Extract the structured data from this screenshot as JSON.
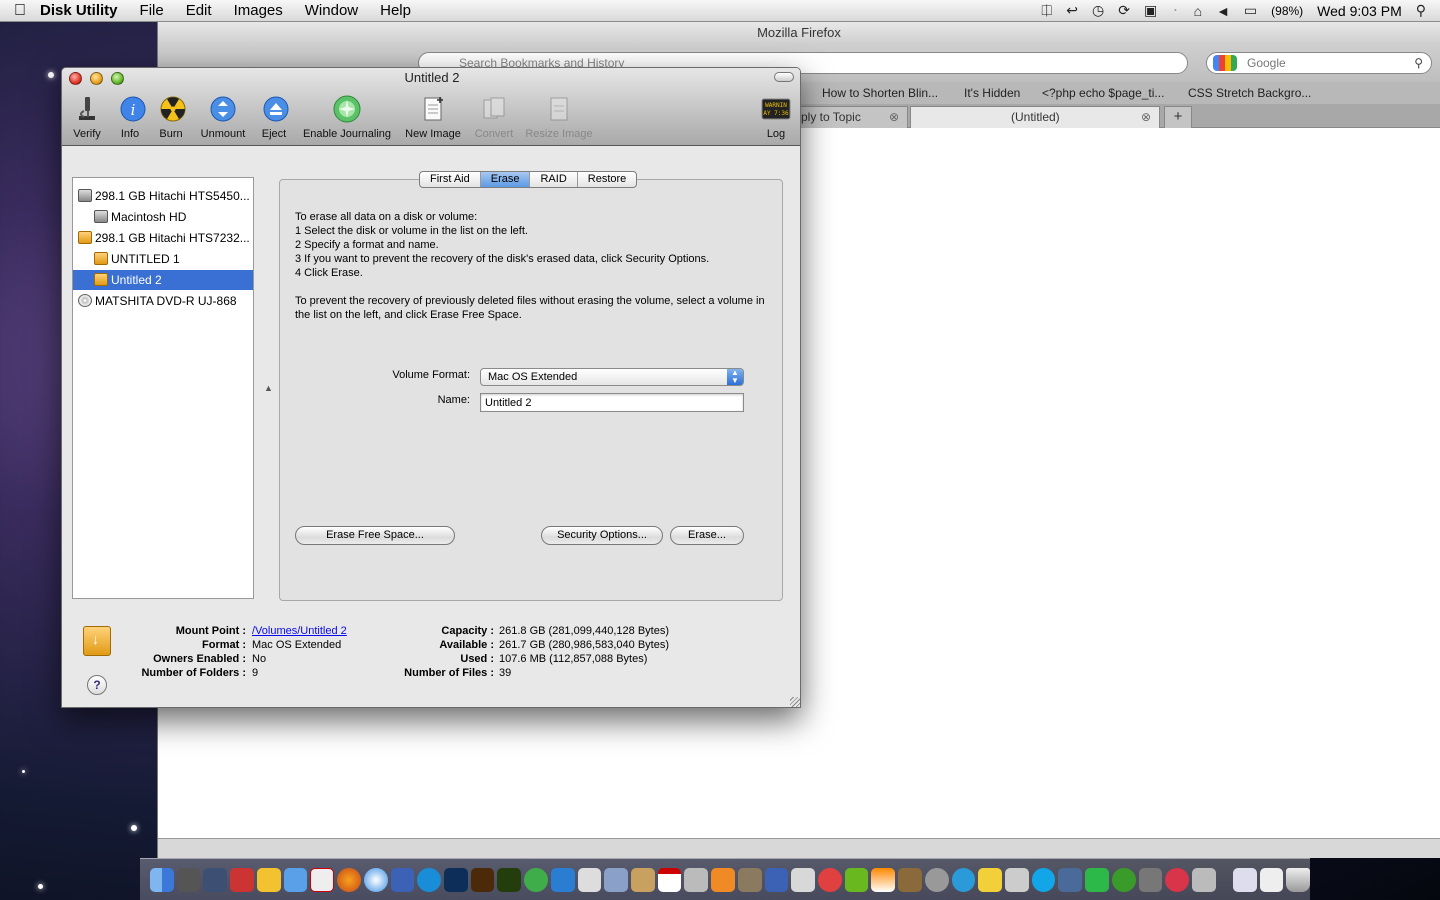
{
  "menubar": {
    "app_name": "Disk Utility",
    "menus": [
      "File",
      "Edit",
      "Images",
      "Window",
      "Help"
    ],
    "battery": "(98%)",
    "clock": "Wed 9:03 PM"
  },
  "firefox": {
    "title": "Mozilla Firefox",
    "url_placeholder": "Search Bookmarks and History",
    "search_placeholder": "Google",
    "bookmarks": [
      "How to Shorten Blin...",
      "It's Hidden",
      "<?php echo $page_ti...",
      "CSS Stretch Backgro..."
    ],
    "tabs": [
      {
        "label": "ply to Topic"
      },
      {
        "label": "(Untitled)"
      }
    ]
  },
  "disk_utility": {
    "title": "Untitled 2",
    "toolbar": [
      {
        "label": "Verify",
        "icon": "microscope-icon",
        "enabled": true
      },
      {
        "label": "Info",
        "icon": "info-icon",
        "enabled": true
      },
      {
        "label": "Burn",
        "icon": "burn-icon",
        "enabled": true
      },
      {
        "label": "Unmount",
        "icon": "unmount-icon",
        "enabled": true
      },
      {
        "label": "Eject",
        "icon": "eject-icon",
        "enabled": true
      },
      {
        "label": "Enable Journaling",
        "icon": "journaling-icon",
        "enabled": true
      },
      {
        "label": "New Image",
        "icon": "new-image-icon",
        "enabled": true
      },
      {
        "label": "Convert",
        "icon": "convert-icon",
        "enabled": false
      },
      {
        "label": "Resize Image",
        "icon": "resize-image-icon",
        "enabled": false
      },
      {
        "label": "Log",
        "icon": "log-icon",
        "enabled": true
      }
    ],
    "log_badge": "WARNIN\nAY 7:36",
    "disks": [
      {
        "label": "298.1 GB Hitachi HTS5450...",
        "type": "hd",
        "level": 0
      },
      {
        "label": "Macintosh HD",
        "type": "hd",
        "level": 1
      },
      {
        "label": "298.1 GB Hitachi HTS7232...",
        "type": "ext",
        "level": 0
      },
      {
        "label": "UNTITLED 1",
        "type": "ext",
        "level": 1
      },
      {
        "label": "Untitled 2",
        "type": "ext",
        "level": 1,
        "selected": true
      },
      {
        "label": "MATSHITA DVD-R UJ-868",
        "type": "dvd",
        "level": 0
      }
    ],
    "tabs": [
      "First Aid",
      "Erase",
      "RAID",
      "Restore"
    ],
    "active_tab": "Erase",
    "instructions": {
      "intro": "To erase all data on a disk or volume:",
      "steps": [
        "1  Select the disk or volume in the list on the left.",
        "2  Specify a format and name.",
        "3  If you want to prevent the recovery of the disk's erased data, click Security Options.",
        "4  Click Erase."
      ],
      "free_space_note": "To prevent the recovery of previously deleted files without erasing the volume, select a volume in the list on the left, and click Erase Free Space."
    },
    "form": {
      "volume_format_label": "Volume Format:",
      "volume_format_value": "Mac OS Extended",
      "name_label": "Name:",
      "name_value": "Untitled 2"
    },
    "buttons": {
      "erase_free_space": "Erase Free Space...",
      "security_options": "Security Options...",
      "erase": "Erase..."
    },
    "info": {
      "mount_point_label": "Mount Point :",
      "mount_point_value": "/Volumes/Untitled 2",
      "format_label": "Format :",
      "format_value": "Mac OS Extended",
      "owners_label": "Owners Enabled :",
      "owners_value": "No",
      "folders_label": "Number of Folders :",
      "folders_value": "9",
      "capacity_label": "Capacity :",
      "capacity_value": "261.8 GB (281,099,440,128 Bytes)",
      "available_label": "Available :",
      "available_value": "261.7 GB (280,986,583,040 Bytes)",
      "used_label": "Used :",
      "used_value": "107.6 MB (112,857,088 Bytes)",
      "files_label": "Number of Files :",
      "files_value": "39"
    }
  },
  "colors": {
    "selection": "#3a70d3",
    "tab_active": "#5d9ae4",
    "link": "#0a0aee"
  }
}
